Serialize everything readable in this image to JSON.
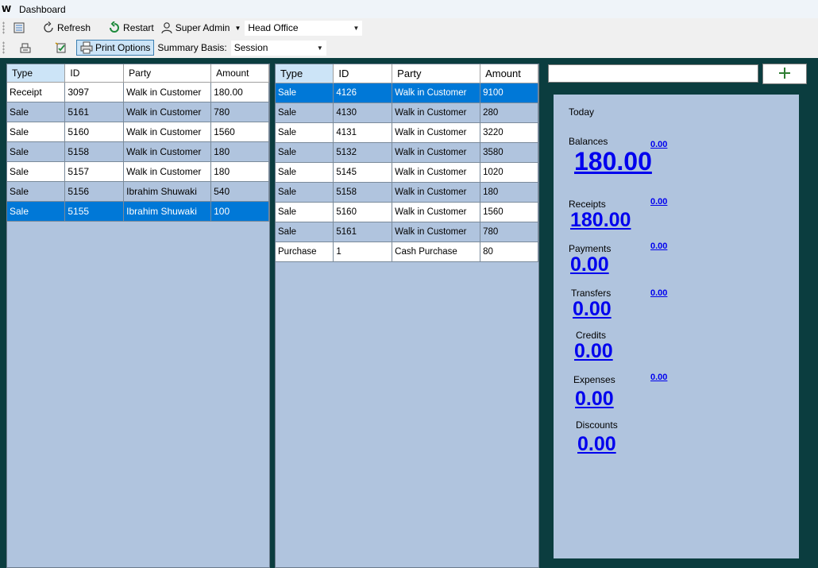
{
  "window": {
    "title": "Dashboard",
    "icon": "app-logo-icon"
  },
  "toolbar1": {
    "refresh_label": "Refresh",
    "restart_label": "Restart",
    "user_label": "Super Admin",
    "branch_value": "Head Office"
  },
  "toolbar2": {
    "print_options_label": "Print Options",
    "summary_basis_label": "Summary Basis:",
    "summary_basis_value": "Session"
  },
  "left_grid": {
    "columns": [
      "Type",
      "ID",
      "Party",
      "Amount"
    ],
    "rows": [
      {
        "type": "Receipt",
        "id": "3097",
        "party": "Walk in Customer",
        "amount": "180.00"
      },
      {
        "type": "Sale",
        "id": "5161",
        "party": "Walk in Customer",
        "amount": "780"
      },
      {
        "type": "Sale",
        "id": "5160",
        "party": "Walk in Customer",
        "amount": "1560"
      },
      {
        "type": "Sale",
        "id": "5158",
        "party": "Walk in Customer",
        "amount": "180"
      },
      {
        "type": "Sale",
        "id": "5157",
        "party": "Walk in Customer",
        "amount": "180"
      },
      {
        "type": "Sale",
        "id": "5156",
        "party": "Ibrahim Shuwaki",
        "amount": "540"
      },
      {
        "type": "Sale",
        "id": "5155",
        "party": "Ibrahim Shuwaki",
        "amount": "100"
      }
    ]
  },
  "right_grid": {
    "columns": [
      "Type",
      "ID",
      "Party",
      "Amount"
    ],
    "rows": [
      {
        "type": "Sale",
        "id": "4126",
        "party": "Walk in Customer",
        "amount": "9100"
      },
      {
        "type": "Sale",
        "id": "4130",
        "party": "Walk in Customer",
        "amount": "280"
      },
      {
        "type": "Sale",
        "id": "4131",
        "party": "Walk in Customer",
        "amount": "3220"
      },
      {
        "type": "Sale",
        "id": "5132",
        "party": "Walk in Customer",
        "amount": "3580"
      },
      {
        "type": "Sale",
        "id": "5145",
        "party": "Walk in Customer",
        "amount": "1020"
      },
      {
        "type": "Sale",
        "id": "5158",
        "party": "Walk in Customer",
        "amount": "180"
      },
      {
        "type": "Sale",
        "id": "5160",
        "party": "Walk in Customer",
        "amount": "1560"
      },
      {
        "type": "Sale",
        "id": "5161",
        "party": "Walk in Customer",
        "amount": "780"
      },
      {
        "type": "Purchase",
        "id": "1",
        "party": "Cash Purchase",
        "amount": "80"
      }
    ]
  },
  "summary": {
    "period_label": "Today",
    "balances": {
      "label": "Balances",
      "value": "180.00",
      "prev": "0.00"
    },
    "receipts": {
      "label": "Receipts",
      "value": "180.00",
      "prev": "0.00"
    },
    "payments": {
      "label": "Payments",
      "value": "0.00",
      "prev": "0.00"
    },
    "transfers": {
      "label": "Transfers",
      "value": "0.00",
      "prev": "0.00"
    },
    "credits": {
      "label": "Credits",
      "value": "0.00"
    },
    "expenses": {
      "label": "Expenses",
      "value": "0.00",
      "prev": "0.00"
    },
    "discounts": {
      "label": "Discounts",
      "value": "0.00"
    }
  },
  "colors": {
    "background": "#0b3d3f",
    "panel": "#b0c4de",
    "selection": "#0078d7",
    "link": "#0000ee",
    "add_icon": "#2e7d32"
  }
}
